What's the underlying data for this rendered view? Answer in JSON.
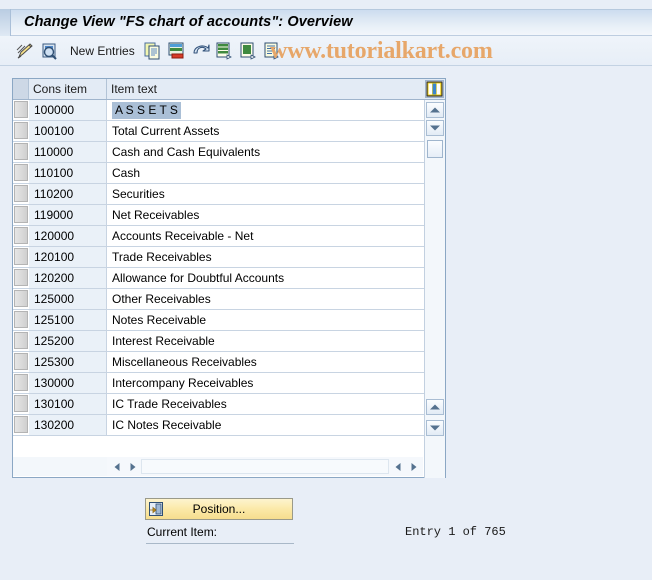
{
  "window": {
    "title": "Change View \"FS chart of accounts\": Overview"
  },
  "watermark": {
    "text": "www.tutorialkart.com",
    "color": "#e7a76a"
  },
  "toolbar": {
    "new_entries_label": "New Entries",
    "icons": [
      "pencil-display-change-icon",
      "magnifier-details-icon",
      "copy-as-icon",
      "delete-row-icon",
      "undo-icon",
      "select-all-icon",
      "deselect-all-icon",
      "variant-icon"
    ]
  },
  "table": {
    "columns": [
      "Cons item",
      "Item text"
    ],
    "config_icon": "table-settings-icon",
    "selected_row_index": 0,
    "rows": [
      {
        "cons_item": "100000",
        "item_text": "A S S E T S"
      },
      {
        "cons_item": "100100",
        "item_text": "Total Current Assets"
      },
      {
        "cons_item": "110000",
        "item_text": "Cash and Cash Equivalents"
      },
      {
        "cons_item": "110100",
        "item_text": "Cash"
      },
      {
        "cons_item": "110200",
        "item_text": "Securities"
      },
      {
        "cons_item": "119000",
        "item_text": "Net Receivables"
      },
      {
        "cons_item": "120000",
        "item_text": "Accounts Receivable - Net"
      },
      {
        "cons_item": "120100",
        "item_text": "Trade Receivables"
      },
      {
        "cons_item": "120200",
        "item_text": "Allowance for Doubtful Accounts"
      },
      {
        "cons_item": "125000",
        "item_text": "Other Receivables"
      },
      {
        "cons_item": "125100",
        "item_text": "Notes Receivable"
      },
      {
        "cons_item": "125200",
        "item_text": "Interest Receivable"
      },
      {
        "cons_item": "125300",
        "item_text": "Miscellaneous Receivables"
      },
      {
        "cons_item": "130000",
        "item_text": "Intercompany Receivables"
      },
      {
        "cons_item": "130100",
        "item_text": "IC Trade Receivables"
      },
      {
        "cons_item": "130200",
        "item_text": "IC Notes Receivable"
      }
    ]
  },
  "footer": {
    "position_button_label": "Position...",
    "position_button_icon": "position-icon",
    "current_item_label": "Current Item:",
    "current_item_value": "",
    "entry_status": "Entry 1 of 765"
  }
}
